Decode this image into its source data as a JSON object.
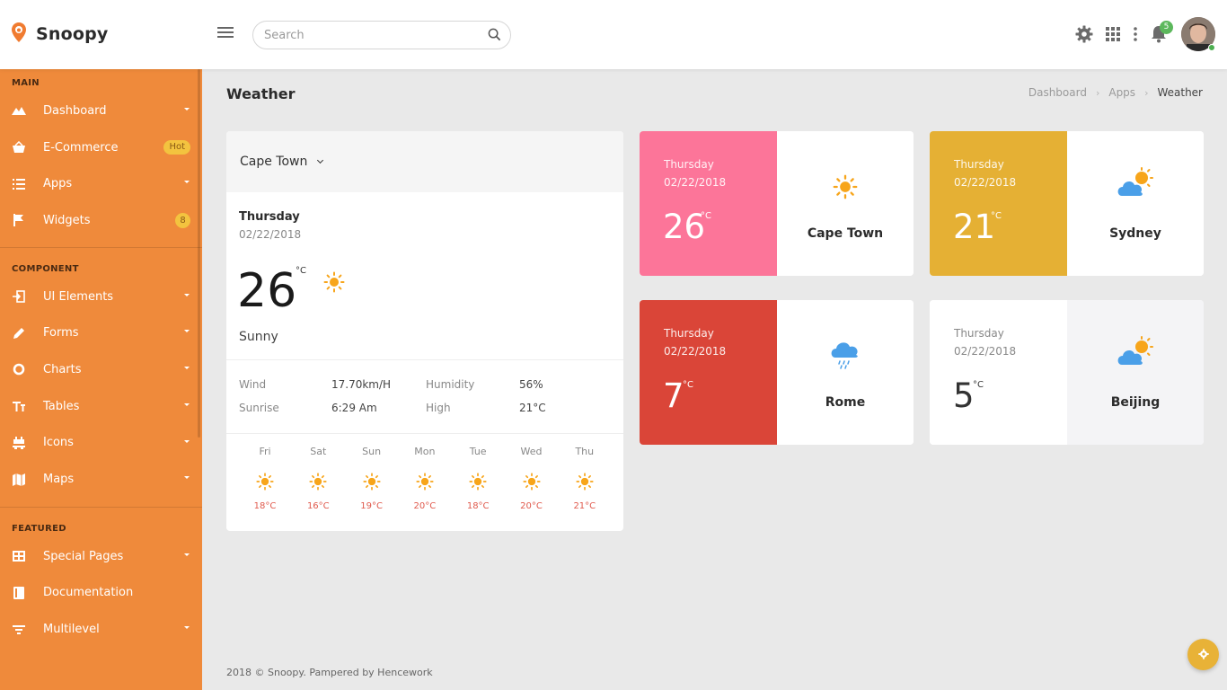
{
  "app": {
    "name": "Snoopy"
  },
  "search": {
    "placeholder": "Search"
  },
  "notifications": {
    "count": "5"
  },
  "sidebar": {
    "sections": [
      {
        "title": "MAIN",
        "items": [
          {
            "label": "Dashboard",
            "icon": "mountain-icon",
            "suffix": "caret"
          },
          {
            "label": "E-Commerce",
            "icon": "basket-icon",
            "suffix": "pill",
            "suffix_text": "Hot"
          },
          {
            "label": "Apps",
            "icon": "list-icon",
            "suffix": "caret"
          },
          {
            "label": "Widgets",
            "icon": "flag-icon",
            "suffix": "circle",
            "suffix_text": "8"
          }
        ]
      },
      {
        "title": "COMPONENT",
        "items": [
          {
            "label": "UI Elements",
            "icon": "login-icon",
            "suffix": "caret"
          },
          {
            "label": "Forms",
            "icon": "pencil-icon",
            "suffix": "caret"
          },
          {
            "label": "Charts",
            "icon": "donut-icon",
            "suffix": "caret"
          },
          {
            "label": "Tables",
            "icon": "text-height-icon",
            "suffix": "caret"
          },
          {
            "label": "Icons",
            "icon": "alien-icon",
            "suffix": "caret"
          },
          {
            "label": "Maps",
            "icon": "map-icon",
            "suffix": "caret"
          }
        ]
      },
      {
        "title": "FEATURED",
        "items": [
          {
            "label": "Special Pages",
            "icon": "layout-icon",
            "suffix": "caret"
          },
          {
            "label": "Documentation",
            "icon": "book-icon",
            "suffix": "none"
          },
          {
            "label": "Multilevel",
            "icon": "filter-icon",
            "suffix": "caret"
          }
        ]
      }
    ]
  },
  "page": {
    "title": "Weather",
    "breadcrumb": [
      "Dashboard",
      "Apps",
      "Weather"
    ]
  },
  "main_weather": {
    "city": "Cape Town",
    "day": "Thursday",
    "date": "02/22/2018",
    "temp": "26",
    "unit": "°C",
    "condition": "Sunny",
    "stats": [
      {
        "label": "Wind",
        "value": "17.70km/H"
      },
      {
        "label": "Humidity",
        "value": "56%"
      },
      {
        "label": "Sunrise",
        "value": "6:29 Am"
      },
      {
        "label": "High",
        "value": "21°C"
      }
    ],
    "forecast": [
      {
        "day": "Fri",
        "temp": "18°C",
        "icon": "sun-icon"
      },
      {
        "day": "Sat",
        "temp": "16°C",
        "icon": "sun-icon"
      },
      {
        "day": "Sun",
        "temp": "19°C",
        "icon": "sun-icon"
      },
      {
        "day": "Mon",
        "temp": "20°C",
        "icon": "sun-icon"
      },
      {
        "day": "Tue",
        "temp": "18°C",
        "icon": "sun-icon"
      },
      {
        "day": "Wed",
        "temp": "20°C",
        "icon": "sun-icon"
      },
      {
        "day": "Thu",
        "temp": "21°C",
        "icon": "sun-icon"
      }
    ]
  },
  "cities": [
    {
      "city": "Cape Town",
      "day": "Thursday",
      "date": "02/22/2018",
      "temp": "26",
      "unit": "°C",
      "icon": "sun-icon",
      "color": "#fc7599",
      "text_color": "#ffffff",
      "right_bg": "#ffffff"
    },
    {
      "city": "Sydney",
      "day": "Thursday",
      "date": "02/22/2018",
      "temp": "21",
      "unit": "°C",
      "icon": "cloud-sun-icon",
      "color": "#e5b034",
      "text_color": "#ffffff",
      "right_bg": "#ffffff"
    },
    {
      "city": "Rome",
      "day": "Thursday",
      "date": "02/22/2018",
      "temp": "7",
      "unit": "°C",
      "icon": "cloud-rain-icon",
      "color": "#da4538",
      "text_color": "#ffffff",
      "right_bg": "#ffffff"
    },
    {
      "city": "Beijing",
      "day": "Thursday",
      "date": "02/22/2018",
      "temp": "5",
      "unit": "°C",
      "icon": "cloud-sun-icon",
      "color": "#ffffff",
      "text_color": "#333333",
      "right_bg": "#f4f4f6"
    }
  ],
  "footer": {
    "text": "2018 © Snoopy. Pampered by Hencework"
  },
  "colors": {
    "sidebar": "#ef8a3b",
    "accent_yellow": "#e8b237",
    "temp_red": "#e05a4d"
  }
}
